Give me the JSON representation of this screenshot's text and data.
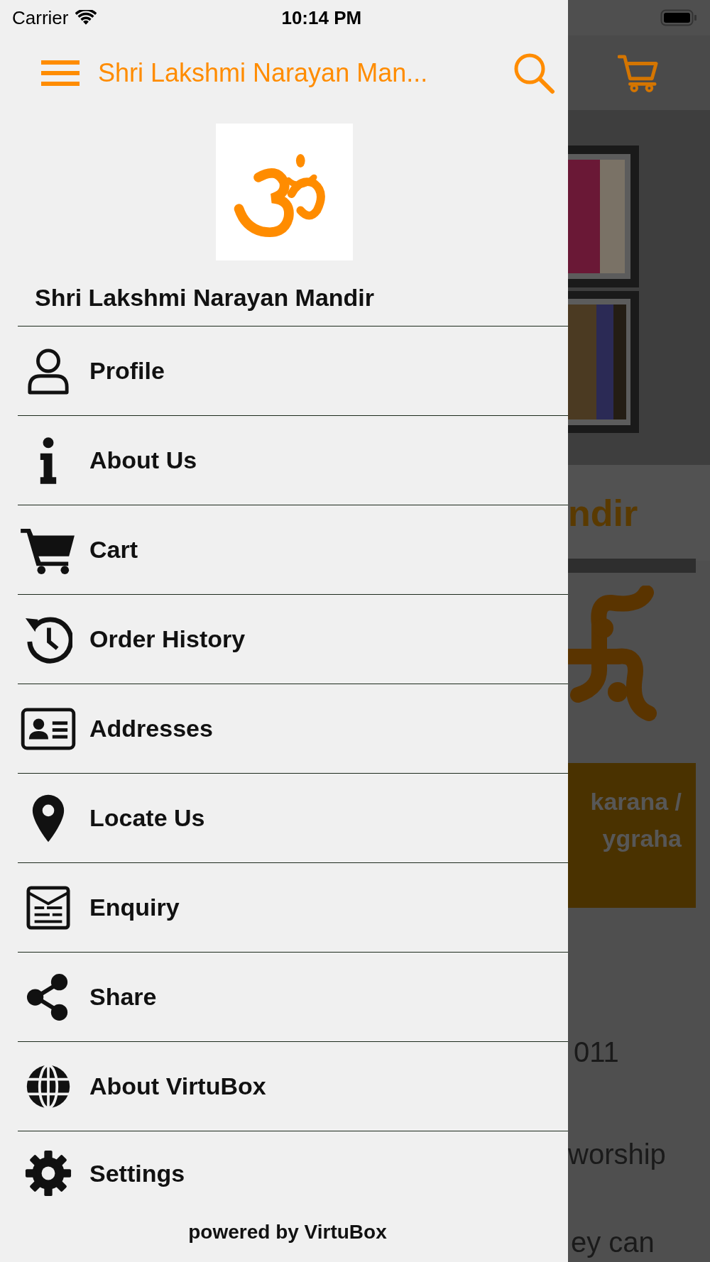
{
  "status_bar": {
    "carrier": "Carrier",
    "time": "10:14 PM"
  },
  "drawer": {
    "header_title": "Shri Lakshmi Narayan Man...",
    "store_name": "Shri Lakshmi Narayan Mandir",
    "menu": [
      {
        "kind": "profile",
        "label": "Profile"
      },
      {
        "kind": "about",
        "label": "About Us"
      },
      {
        "kind": "cart",
        "label": "Cart"
      },
      {
        "kind": "history",
        "label": "Order History"
      },
      {
        "kind": "addresses",
        "label": "Addresses"
      },
      {
        "kind": "locate",
        "label": "Locate Us"
      },
      {
        "kind": "enquiry",
        "label": "Enquiry"
      },
      {
        "kind": "share",
        "label": "Share"
      },
      {
        "kind": "globe",
        "label": "About VirtuBox"
      },
      {
        "kind": "settings",
        "label": "Settings"
      }
    ],
    "footer": "powered by VirtuBox"
  },
  "background_page": {
    "heading": "ndir",
    "button_lines": [
      "karana /",
      "ygraha"
    ],
    "texts": [
      "011",
      "worship",
      "ey can"
    ]
  }
}
